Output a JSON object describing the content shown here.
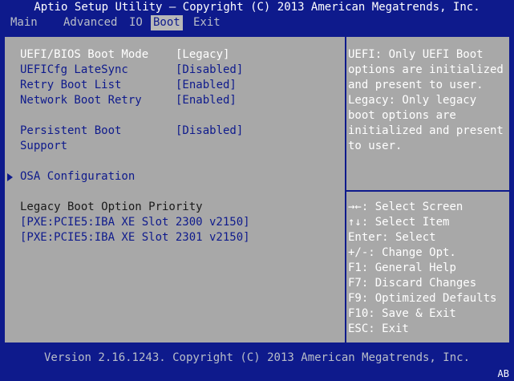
{
  "title": "Aptio Setup Utility – Copyright (C) 2013 American Megatrends, Inc.",
  "menu": [
    {
      "label": "Main",
      "active": false
    },
    {
      "label": "Advanced",
      "active": false
    },
    {
      "label": "IO",
      "active": false
    },
    {
      "label": "Boot",
      "active": true
    },
    {
      "label": "Exit",
      "active": false
    }
  ],
  "settings": {
    "boot_mode": {
      "label": "UEFI/BIOS Boot Mode",
      "value": "[Legacy]"
    },
    "latesync": {
      "label": "UEFICfg LateSync",
      "value": "[Disabled]"
    },
    "retry_boot_list": {
      "label": "Retry Boot List",
      "value": "[Enabled]"
    },
    "network_boot_retry": {
      "label": "Network Boot Retry",
      "value": "[Enabled]"
    },
    "persistent_boot": {
      "label_line1": "Persistent Boot",
      "label_line2": "Support",
      "value": "[Disabled]"
    },
    "osa": {
      "label": "OSA Configuration"
    }
  },
  "legacy_priority": {
    "heading": "Legacy Boot Option Priority",
    "options": [
      "[PXE:PCIE5:IBA XE Slot 2300 v2150]",
      "[PXE:PCIE5:IBA XE Slot 2301 v2150]"
    ]
  },
  "help_text": [
    "UEFI: Only UEFI Boot",
    "options are initialized",
    "and present to user.",
    "Legacy: Only legacy",
    "boot options are",
    "initialized and present",
    "to user."
  ],
  "keys": [
    {
      "key": "→←:",
      "desc": " Select Screen"
    },
    {
      "key": "↑↓:",
      "desc": " Select Item"
    },
    {
      "key": "Enter:",
      "desc": " Select"
    },
    {
      "key": "+/-:",
      "desc": " Change Opt."
    },
    {
      "key": "F1:",
      "desc": " General Help"
    },
    {
      "key": "F7:",
      "desc": " Discard Changes"
    },
    {
      "key": "F9:",
      "desc": " Optimized Defaults"
    },
    {
      "key": "F10:",
      "desc": " Save & Exit"
    },
    {
      "key": "ESC:",
      "desc": " Exit"
    }
  ],
  "footer": "Version 2.16.1243. Copyright (C) 2013 American Megatrends, Inc.",
  "corner_code": "AB",
  "colors": {
    "background": "#0e1a8c",
    "panel": "#a8a8a8",
    "highlight_text": "#ffffff"
  }
}
